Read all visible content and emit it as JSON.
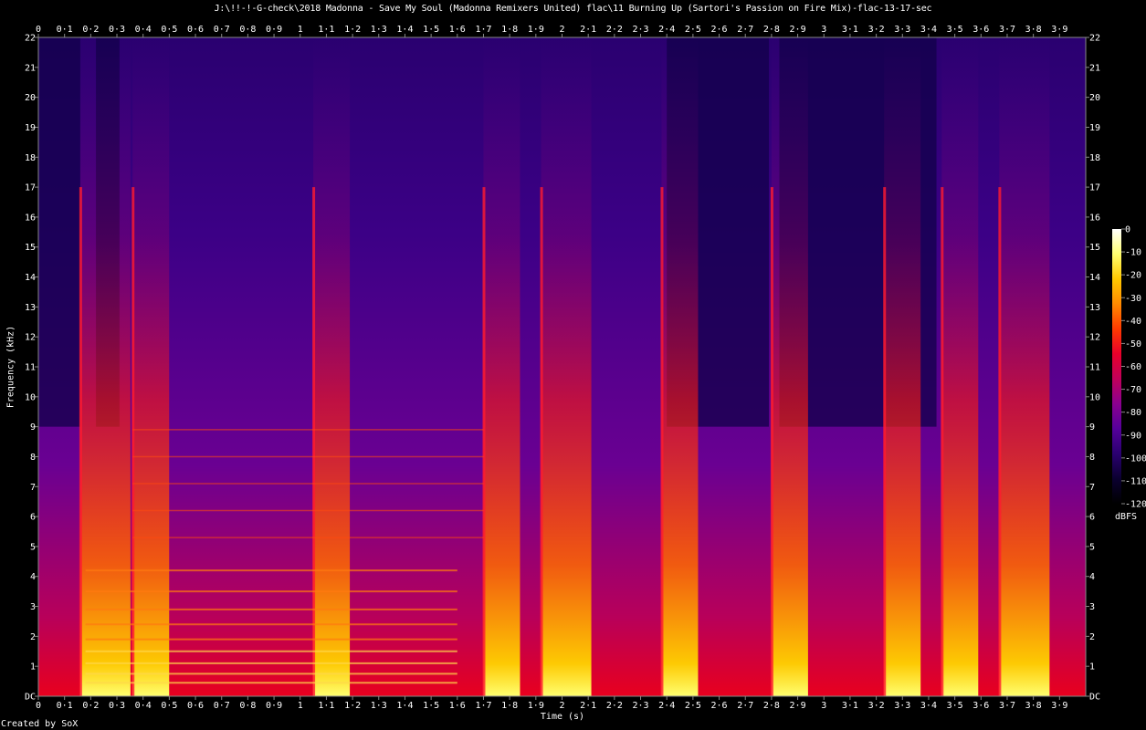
{
  "title": "J:\\!!-!-G-check\\2018 Madonna - Save My Soul (Madonna Remixers United) flac\\11 Burning Up (Sartori's Passion on Fire Mix)-flac-13-17-sec",
  "footer": "Created by SoX",
  "colorbar_unit": "dBFS",
  "chart_data": {
    "type": "heatmap",
    "title": "J:\\!!-!-G-check\\2018 Madonna - Save My Soul (Madonna Remixers United) flac\\11 Burning Up (Sartori's Passion on Fire Mix)-flac-13-17-sec",
    "xlabel": "Time (s)",
    "ylabel": "Frequency (kHz)",
    "xlim": [
      0,
      4.0
    ],
    "ylim": [
      0,
      22
    ],
    "x_ticks": [
      "0",
      "0·1",
      "0·2",
      "0·3",
      "0·4",
      "0·5",
      "0·6",
      "0·7",
      "0·8",
      "0·9",
      "1",
      "1·1",
      "1·2",
      "1·3",
      "1·4",
      "1·5",
      "1·6",
      "1·7",
      "1·8",
      "1·9",
      "2",
      "2·1",
      "2·2",
      "2·3",
      "2·4",
      "2·5",
      "2·6",
      "2·7",
      "2·8",
      "2·9",
      "3",
      "3·1",
      "3·2",
      "3·3",
      "3·4",
      "3·5",
      "3·6",
      "3·7",
      "3·8",
      "3·9"
    ],
    "y_ticks": [
      "DC",
      "1",
      "2",
      "3",
      "4",
      "5",
      "6",
      "7",
      "8",
      "9",
      "10",
      "11",
      "12",
      "13",
      "14",
      "15",
      "16",
      "17",
      "18",
      "19",
      "20",
      "21",
      "22"
    ],
    "colorbar": {
      "label": "dBFS",
      "range": [
        -120,
        0
      ],
      "ticks": [
        "0",
        "-10",
        "-20",
        "-30",
        "-40",
        "-50",
        "-60",
        "-70",
        "-80",
        "-90",
        "-100",
        "-110",
        "-120"
      ]
    },
    "colormap": [
      "#000000",
      "#0b0030",
      "#2a0070",
      "#55009a",
      "#8a0090",
      "#c0005a",
      "#e8002a",
      "#ff3a00",
      "#ff8a00",
      "#ffc800",
      "#ffff70",
      "#ffffff"
    ],
    "onsets_s": [
      0.16,
      0.36,
      1.05,
      1.7,
      1.92,
      2.38,
      2.8,
      3.23,
      3.45,
      3.67
    ],
    "grid": false
  }
}
